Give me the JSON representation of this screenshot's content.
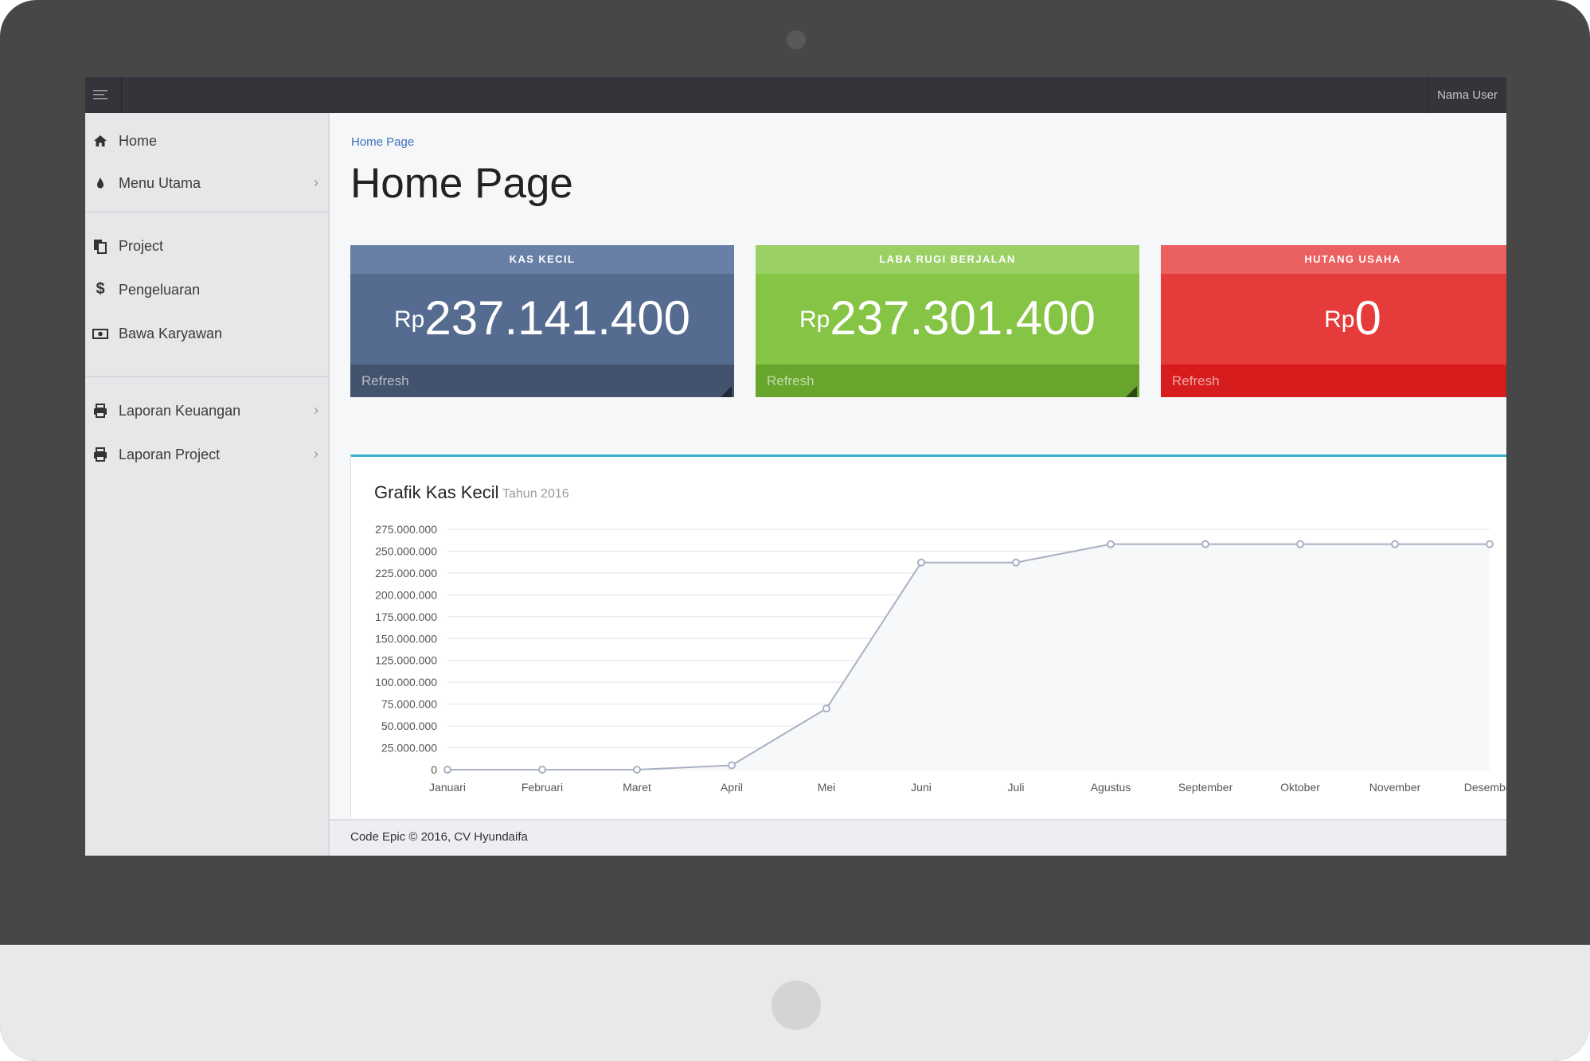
{
  "topbar": {
    "menu_icon": "hamburger-icon",
    "user_name": "Nama User"
  },
  "sidebar": {
    "items": [
      {
        "label": "Home",
        "icon": "home-icon"
      },
      {
        "label": "Menu Utama",
        "icon": "drop-icon",
        "has_submenu": true
      },
      {
        "label": "Project",
        "icon": "copy-icon"
      },
      {
        "label": "Pengeluaran",
        "icon": "dollar-icon"
      },
      {
        "label": "Bawa Karyawan",
        "icon": "money-icon"
      },
      {
        "label": "Laporan Keuangan",
        "icon": "print-icon",
        "has_submenu": true
      },
      {
        "label": "Laporan Project",
        "icon": "print-icon",
        "has_submenu": true
      }
    ]
  },
  "breadcrumb": "Home Page",
  "page_title": "Home Page",
  "cards": [
    {
      "title": "KAS KECIL",
      "currency": "Rp",
      "value": "237.141.400",
      "footer": "Refresh",
      "color": "#556b8f"
    },
    {
      "title": "LABA RUGI BERJALAN",
      "currency": "Rp",
      "value": "237.301.400",
      "footer": "Refresh",
      "color": "#85c444"
    },
    {
      "title": "HUTANG USAHA",
      "currency": "Rp",
      "value": "0",
      "footer": "Refresh",
      "color": "#e53b3b"
    }
  ],
  "panel": {
    "title": "Grafik Kas Kecil",
    "subtitle": "Tahun 2016"
  },
  "chart_data": {
    "type": "area",
    "categories": [
      "Januari",
      "Februari",
      "Maret",
      "April",
      "Mei",
      "Juni",
      "Juli",
      "Agustus",
      "September",
      "Oktober",
      "November",
      "Desember"
    ],
    "values": [
      0,
      0,
      0,
      5000000,
      70000000,
      237000000,
      237000000,
      258000000,
      258000000,
      258000000,
      258000000,
      258000000
    ],
    "ylim": [
      0,
      275000000
    ],
    "yticks": [
      "0",
      "25.000.000",
      "50.000.000",
      "75.000.000",
      "100.000.000",
      "125.000.000",
      "150.000.000",
      "175.000.000",
      "200.000.000",
      "225.000.000",
      "250.000.000",
      "275.000.000"
    ],
    "grid": true,
    "line_color": "#a9b0c4"
  },
  "footer": "Code Epic © 2016, CV Hyundaifa"
}
